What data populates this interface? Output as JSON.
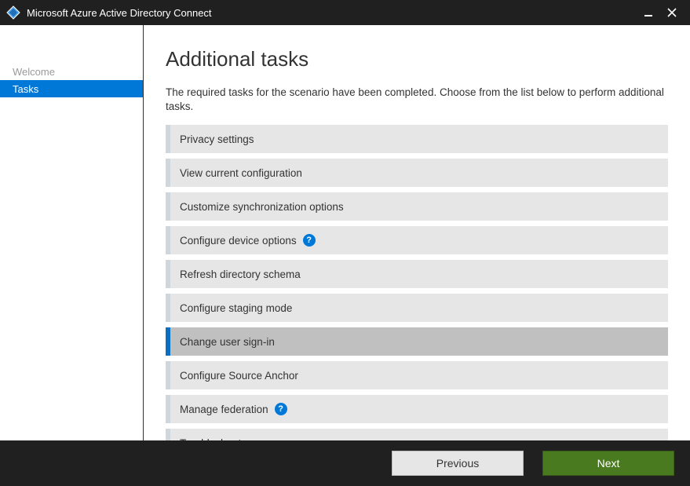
{
  "window": {
    "title": "Microsoft Azure Active Directory Connect"
  },
  "sidebar": {
    "items": [
      {
        "label": "Welcome",
        "active": false
      },
      {
        "label": "Tasks",
        "active": true
      }
    ]
  },
  "page": {
    "title": "Additional tasks",
    "description": "The required tasks for the scenario have been completed. Choose from the list below to perform additional tasks."
  },
  "tasks": [
    {
      "label": "Privacy settings",
      "help": false,
      "selected": false
    },
    {
      "label": "View current configuration",
      "help": false,
      "selected": false
    },
    {
      "label": "Customize synchronization options",
      "help": false,
      "selected": false
    },
    {
      "label": "Configure device options",
      "help": true,
      "selected": false
    },
    {
      "label": "Refresh directory schema",
      "help": false,
      "selected": false
    },
    {
      "label": "Configure staging mode",
      "help": false,
      "selected": false
    },
    {
      "label": "Change user sign-in",
      "help": false,
      "selected": true
    },
    {
      "label": "Configure Source Anchor",
      "help": false,
      "selected": false
    },
    {
      "label": "Manage federation",
      "help": true,
      "selected": false
    },
    {
      "label": "Troubleshoot",
      "help": false,
      "selected": false
    }
  ],
  "footer": {
    "previous": "Previous",
    "next": "Next"
  },
  "colors": {
    "accent": "#0078d7",
    "nextButton": "#4a7a1f"
  }
}
